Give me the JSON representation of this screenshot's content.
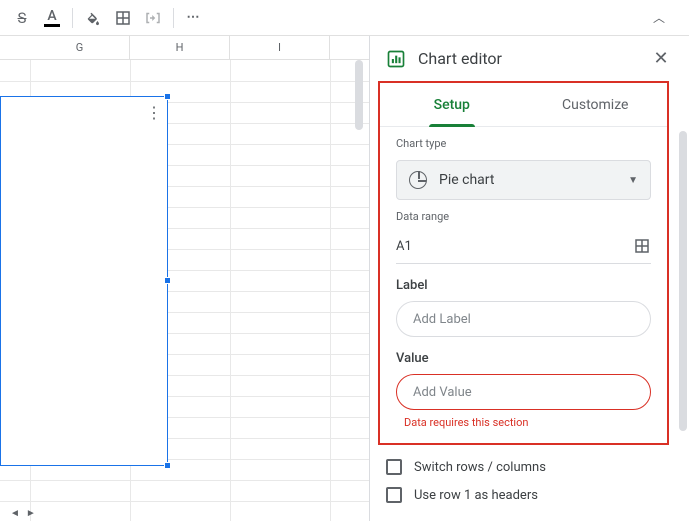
{
  "toolbar": {
    "strikethrough_label": "S",
    "text_color_label": "A"
  },
  "columns": [
    "G",
    "H",
    "I"
  ],
  "panel": {
    "title": "Chart editor",
    "tabs": {
      "setup": "Setup",
      "customize": "Customize"
    },
    "chart_type": {
      "label": "Chart type",
      "value": "Pie chart"
    },
    "data_range": {
      "label": "Data range",
      "value": "A1"
    },
    "label_field": {
      "label": "Label",
      "placeholder": "Add Label"
    },
    "value_field": {
      "label": "Value",
      "placeholder": "Add Value",
      "error": "Data requires this section"
    },
    "options": {
      "switch_rows": "Switch rows / columns",
      "row1_headers": "Use row 1 as headers"
    }
  }
}
